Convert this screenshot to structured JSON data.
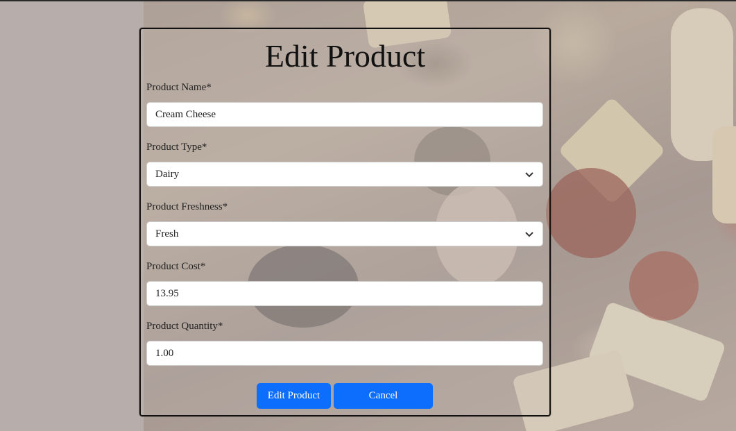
{
  "form": {
    "title": "Edit Product",
    "fields": [
      {
        "label": "Product Name*",
        "value": "Cream Cheese",
        "kind": "text"
      },
      {
        "label": "Product Type*",
        "value": "Dairy",
        "kind": "select"
      },
      {
        "label": "Product Freshness*",
        "value": "Fresh",
        "kind": "select"
      },
      {
        "label": "Product Cost*",
        "value": "13.95",
        "kind": "text"
      },
      {
        "label": "Product Quantity*",
        "value": "1.00",
        "kind": "text"
      }
    ],
    "submit_label": "Edit Product",
    "cancel_label": "Cancel"
  },
  "icons": {
    "select_arrow": "chevron-down-icon"
  },
  "colors": {
    "primary": "#0d6efd"
  }
}
